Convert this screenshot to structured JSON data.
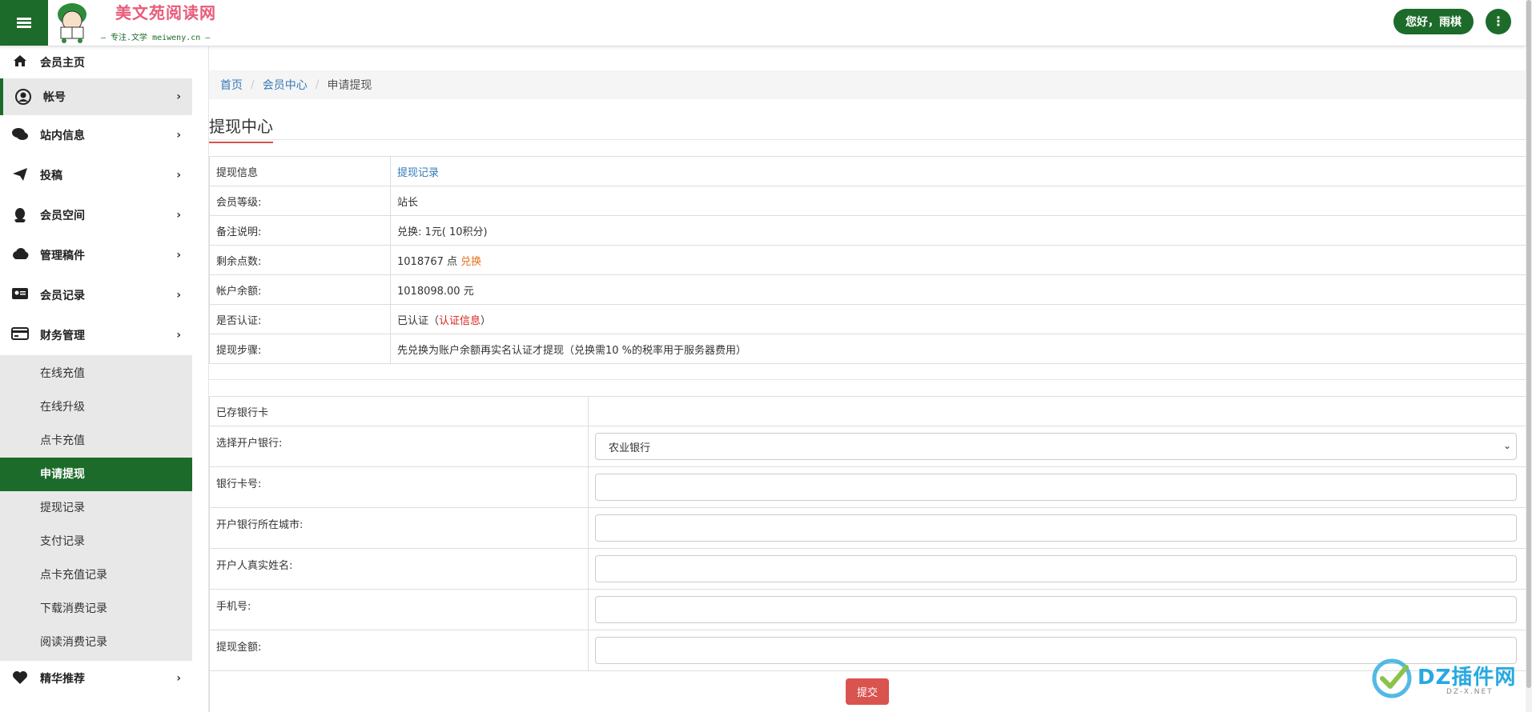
{
  "header": {
    "logo_title": "美文苑阅读网",
    "logo_sub": "— 专注.文学 meiweny.cn —",
    "greeting": "您好，雨棋"
  },
  "sidebar": {
    "items": [
      {
        "label": "会员主页",
        "icon": "home-icon"
      },
      {
        "label": "帐号",
        "icon": "user-circle-icon"
      },
      {
        "label": "站内信息",
        "icon": "comments-icon"
      },
      {
        "label": "投稿",
        "icon": "paper-plane-icon"
      },
      {
        "label": "会员空间",
        "icon": "qq-icon"
      },
      {
        "label": "管理稿件",
        "icon": "cloud-icon"
      },
      {
        "label": "会员记录",
        "icon": "id-card-icon"
      },
      {
        "label": "财务管理",
        "icon": "credit-card-icon"
      }
    ],
    "submenu": [
      "在线充值",
      "在线升级",
      "点卡充值",
      "申请提现",
      "提现记录",
      "支付记录",
      "点卡充值记录",
      "下载消费记录",
      "阅读消费记录"
    ],
    "last_item": {
      "label": "精华推荐",
      "icon": "heart-icon"
    }
  },
  "breadcrumb": {
    "home": "首页",
    "member": "会员中心",
    "current": "申请提现"
  },
  "page_title": "提现中心",
  "info": {
    "r0_label": "提现信息",
    "r0_value": "提现记录",
    "r1_label": "会员等级:",
    "r1_value": "站长",
    "r2_label": "备注说明:",
    "r2_value": "兑换: 1元( 10积分)",
    "r3_label": "剩余点数:",
    "r3_value": "1018767 点",
    "r3_link": "兑换",
    "r4_label": "帐户余额:",
    "r4_value": "1018098.00 元",
    "r5_label": "是否认证:",
    "r5_value": "已认证（",
    "r5_link": "认证信息",
    "r5_close": "）",
    "r6_label": "提现步骤:",
    "r6_value": "先兑换为账户余额再实名认证才提现（兑换需10 %的税率用于服务器费用）"
  },
  "form": {
    "saved_card": "已存银行卡",
    "bank_label": "选择开户银行:",
    "bank_value": "农业银行",
    "card_label": "银行卡号:",
    "city_label": "开户银行所在城市:",
    "name_label": "开户人真实姓名:",
    "phone_label": "手机号:",
    "amount_label": "提现金额:",
    "submit": "提交"
  },
  "watermark": {
    "text": "DZ插件网",
    "sub": "DZ-X.NET"
  },
  "colors": {
    "brand_green": "#1d6b2a",
    "accent_red": "#d9534f",
    "link_blue": "#337ab7",
    "highlight_orange": "#e8701a"
  }
}
